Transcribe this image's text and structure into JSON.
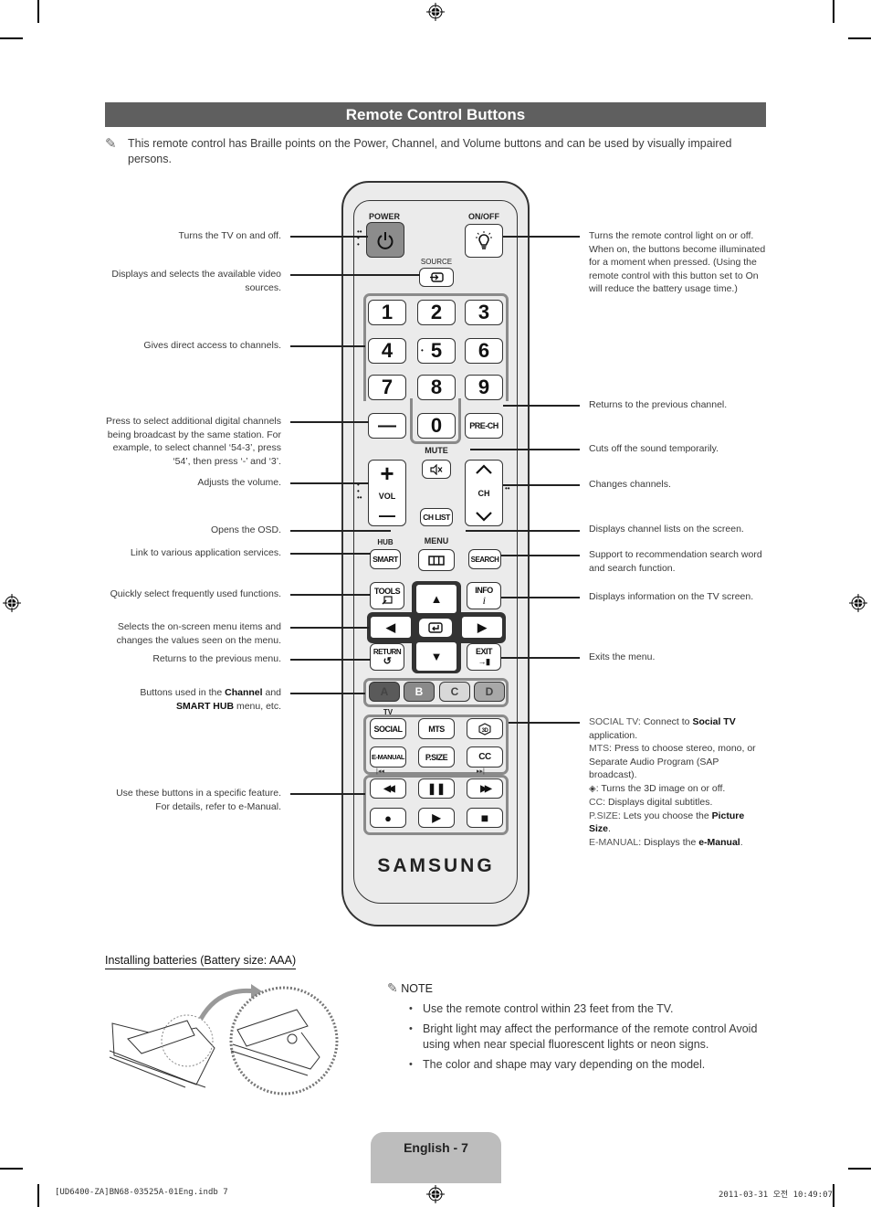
{
  "header": {
    "title": "Remote Control Buttons",
    "intro": "This remote control has Braille points on the Power, Channel, and Volume buttons and can be used by visually impaired persons.",
    "intro_icon": "pencil-note-icon"
  },
  "remote": {
    "labels": {
      "power": "POWER",
      "onoff": "ON/OFF",
      "source": "SOURCE",
      "mute": "MUTE",
      "hub": "HUB",
      "menu": "MENU",
      "tv": "TV",
      "brand": "SAMSUNG"
    },
    "keypad": [
      "1",
      "2",
      "3",
      "4",
      "5",
      "6",
      "7",
      "8",
      "9"
    ],
    "dash": "—",
    "zero": "0",
    "prech": "PRE-CH",
    "vol": "VOL",
    "vol_plus": "+",
    "vol_minus": "—",
    "ch": "CH",
    "chlist": "CH LIST",
    "smart": "SMART",
    "search": "SEARCH",
    "tools": "TOOLS",
    "info": "INFO",
    "info_glyph": "i",
    "return": "RETURN",
    "exit": "EXIT",
    "color_keys": [
      {
        "label": "A",
        "color": "#5a5a5a"
      },
      {
        "label": "B",
        "color": "#8a8a8a"
      },
      {
        "label": "C",
        "color": "#d8d8d8"
      },
      {
        "label": "D",
        "color": "#a8a8a8"
      }
    ],
    "function_keys": [
      "SOCIAL",
      "MTS",
      "3D",
      "E-MANUAL",
      "P.SIZE",
      "CC"
    ],
    "media_keys": [
      "rewind",
      "pause",
      "fast-forward",
      "record",
      "play",
      "stop"
    ],
    "media_glyphs": [
      "◀◀",
      "❚❚",
      "▶▶",
      "●",
      "▶",
      "■"
    ],
    "arrows": {
      "up": "▲",
      "down": "▼",
      "left": "◀",
      "right": "▶"
    }
  },
  "callouts_left": [
    "Turns the TV on and off.",
    "Displays and selects the available video sources.",
    "Gives direct access to channels.",
    "Press to select additional digital channels being broadcast by the same station. For example, to select channel ‘54-3’, press ‘54’, then press ‘-’ and ‘3’.",
    "Adjusts the volume.",
    "Opens the OSD.",
    "Link to various application services.",
    "Quickly select frequently used functions.",
    "Selects the on-screen menu items and changes the values seen on the menu.",
    "Returns to the previous menu.",
    "Use these buttons in a specific feature. For details, refer to e-Manual."
  ],
  "callout_color_buttons": {
    "pre": "Buttons used in the ",
    "b1": "Channel",
    "mid": " and ",
    "b2": "SMART HUB",
    "post": " menu, etc."
  },
  "callouts_right": [
    "Turns the remote control light on or off. When on, the buttons become illuminated for a moment when pressed. (Using the remote control with this button set to On will reduce the battery usage time.)",
    "Returns to the previous channel.",
    "Cuts off the sound temporarily.",
    "Changes channels.",
    "Displays channel lists on the screen.",
    "Support to recommendation search word and search function.",
    "Displays information on the TV screen.",
    "Exits the menu."
  ],
  "callout_functions": {
    "social_key": "SOCIAL TV",
    "social_pre": ": Connect to ",
    "social_bold": "Social TV",
    "social_post": " application.",
    "mts_key": "MTS",
    "mts_text": ": Press to choose stereo, mono, or Separate Audio Program (SAP broadcast).",
    "threed_text": ": Turns the 3D image on or off.",
    "cc_key": "CC",
    "cc_text": ": Displays digital subtitles.",
    "psize_key": "P.SIZE",
    "psize_pre": ": Lets you choose the ",
    "psize_bold": "Picture Size",
    "psize_post": ".",
    "emanual_key": "E-MANUAL",
    "emanual_pre": ": Displays the ",
    "emanual_bold": "e-Manual",
    "emanual_post": "."
  },
  "batteries": {
    "title": "Installing batteries (Battery size: AAA)",
    "note_label": "NOTE",
    "notes": [
      "Use the remote control within 23 feet from the TV.",
      "Bright light may affect the performance of the remote control Avoid using when near special fluorescent lights or neon signs.",
      "The color and shape may vary depending on the model."
    ]
  },
  "footer": {
    "page_label": "English - 7",
    "file": "[UD6400-ZA]BN68-03525A-01Eng.indb   7",
    "timestamp": "2011-03-31   오전 10:49:07"
  }
}
